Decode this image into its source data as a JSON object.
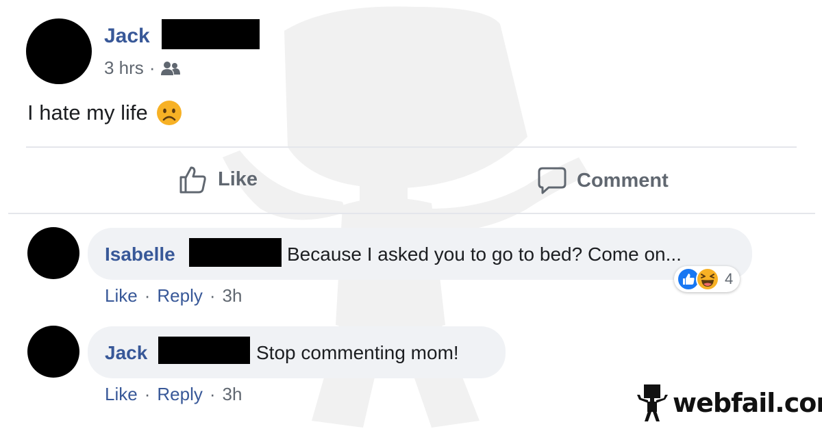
{
  "post": {
    "author_name": "Jack",
    "time": "3 hrs",
    "separator": "·",
    "audience_icon": "friends-icon",
    "text": "I hate my life",
    "emoji": "frowning-face-emoji"
  },
  "actions": {
    "like_label": "Like",
    "comment_label": "Comment"
  },
  "comments": [
    {
      "author": "Isabelle",
      "text": "Because I asked you to go to bed? Come on...",
      "like": "Like",
      "sep": "·",
      "reply": "Reply",
      "time": "3h",
      "reactions": {
        "icons": [
          "like-reaction-icon",
          "haha-reaction-icon"
        ],
        "count": "4"
      }
    },
    {
      "author": "Jack",
      "text": "Stop commenting mom!",
      "like": "Like",
      "sep": "·",
      "reply": "Reply",
      "time": "3h"
    }
  ],
  "watermark": {
    "logo_text": "webfail.com",
    "figure_icon": "webfail-mascot-icon"
  },
  "colors": {
    "link_blue": "#385898",
    "meta_gray": "#606770",
    "bubble_bg": "#f0f2f5",
    "divider": "#e4e6eb",
    "like_blue": "#1877f2",
    "haha_yellow": "#f7b125"
  }
}
